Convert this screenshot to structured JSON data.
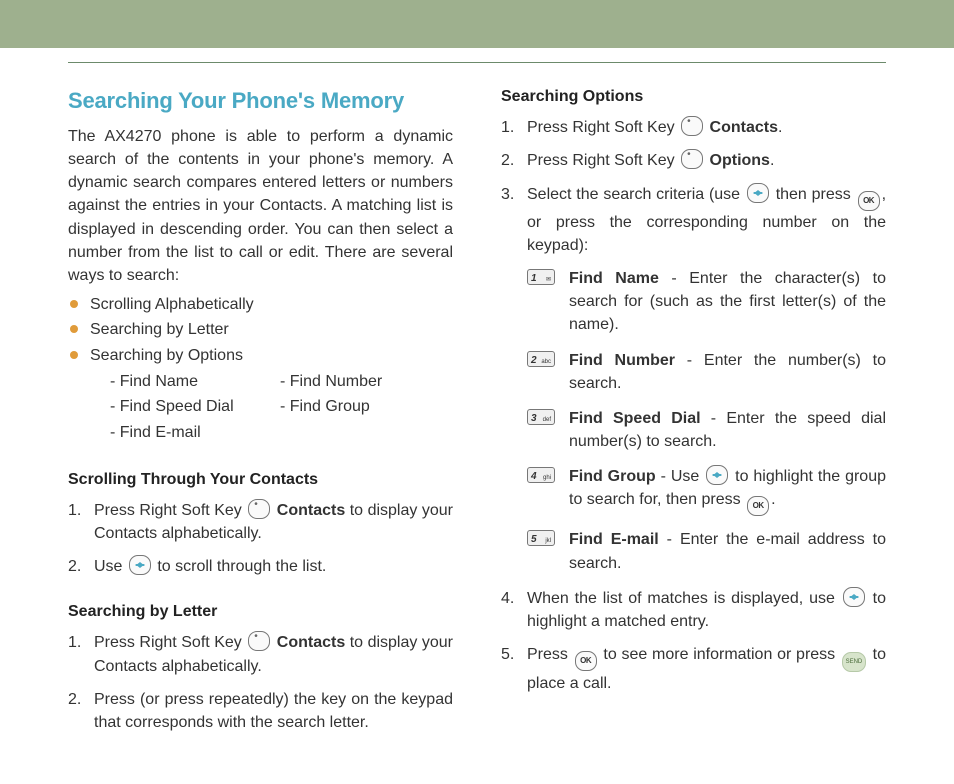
{
  "left": {
    "title": "Searching Your Phone's Memory",
    "intro": "The AX4270 phone is able to perform a dynamic search of the contents in your phone's memory. A dynamic search compares entered letters or numbers against the entries in your Contacts. A matching list is displayed in descending order. You can then select a number from the list to call or edit. There are several ways to search:",
    "bullets": [
      "Scrolling Alphabetically",
      "Searching by Letter",
      "Searching by Options"
    ],
    "subopt_r1c1": "- Find Name",
    "subopt_r1c2": "- Find Number",
    "subopt_r2c1": "- Find Speed Dial",
    "subopt_r2c2": "- Find Group",
    "subopt_r3c1": "- Find E-mail",
    "sub1_head": "Scrolling Through Your Contacts",
    "sub1_s1a": "Press Right Soft Key ",
    "sub1_s1b": " Contacts",
    "sub1_s1c": " to display your Contacts alphabetically.",
    "sub1_s2a": "Use ",
    "sub1_s2b": " to scroll through the list.",
    "sub2_head": "Searching by Letter",
    "sub2_s1a": "Press Right Soft Key ",
    "sub2_s1b": " Contacts",
    "sub2_s1c": " to display your Contacts alphabetically.",
    "sub2_s2": "Press (or press repeatedly) the key on the keypad that corresponds with the search letter."
  },
  "right": {
    "head": "Searching Options",
    "s1a": "Press Right Soft Key ",
    "s1b": " Contacts",
    "s1_end": ".",
    "s2a": "Press Right Soft Key ",
    "s2b": " Options",
    "s2_end": ".",
    "s3a": "Select the search criteria (use ",
    "s3b": " then press ",
    "s3c": ", or press the corresponding number on the keypad):",
    "keys": {
      "k1": {
        "n": "1",
        "s": "",
        "label": "Find Name",
        "desc": " - Enter the character(s) to search for (such as the first letter(s) of the name)."
      },
      "k2": {
        "n": "2",
        "s": "abc",
        "label": "Find Number",
        "desc": " - Enter the number(s) to search."
      },
      "k3": {
        "n": "3",
        "s": "def",
        "label": "Find Speed Dial",
        "desc": " - Enter the speed dial number(s) to search."
      },
      "k4": {
        "n": "4",
        "s": "ghi",
        "label": "Find Group",
        "before": " - Use ",
        "after": " to highlight the group to search for, then press "
      },
      "k5": {
        "n": "5",
        "s": "jkl",
        "label": "Find E-mail",
        "desc": " - Enter the e-mail address to search."
      }
    },
    "s4a": "When the list of matches is displayed, use ",
    "s4b": " to highlight a matched entry.",
    "s5a": "Press ",
    "s5b": " to see more information or press ",
    "s5c": " to place a call.",
    "ok_text": "OK",
    "send_text": "SEND"
  }
}
